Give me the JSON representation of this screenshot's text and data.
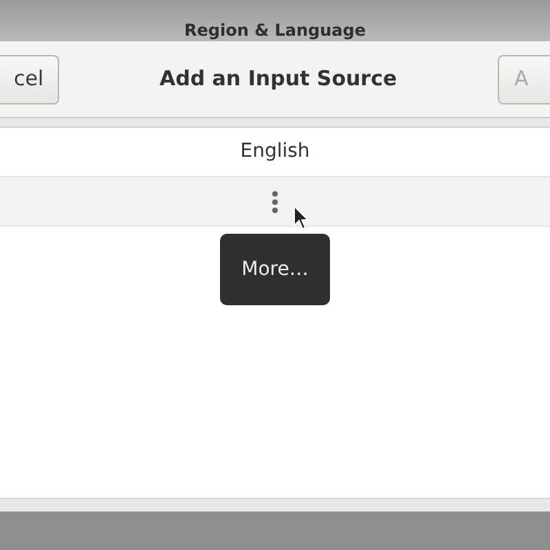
{
  "background_window": {
    "title": "Region & Language"
  },
  "dialog": {
    "title": "Add an Input Source",
    "buttons": [
      {
        "kind": "cancel",
        "label": "cel"
      },
      {
        "kind": "add",
        "label": "A"
      }
    ],
    "rows": [
      {
        "kind": "text",
        "label": "English",
        "hovered": false
      },
      {
        "kind": "more",
        "hovered": true
      }
    ],
    "tooltip": {
      "text": "More…"
    }
  }
}
